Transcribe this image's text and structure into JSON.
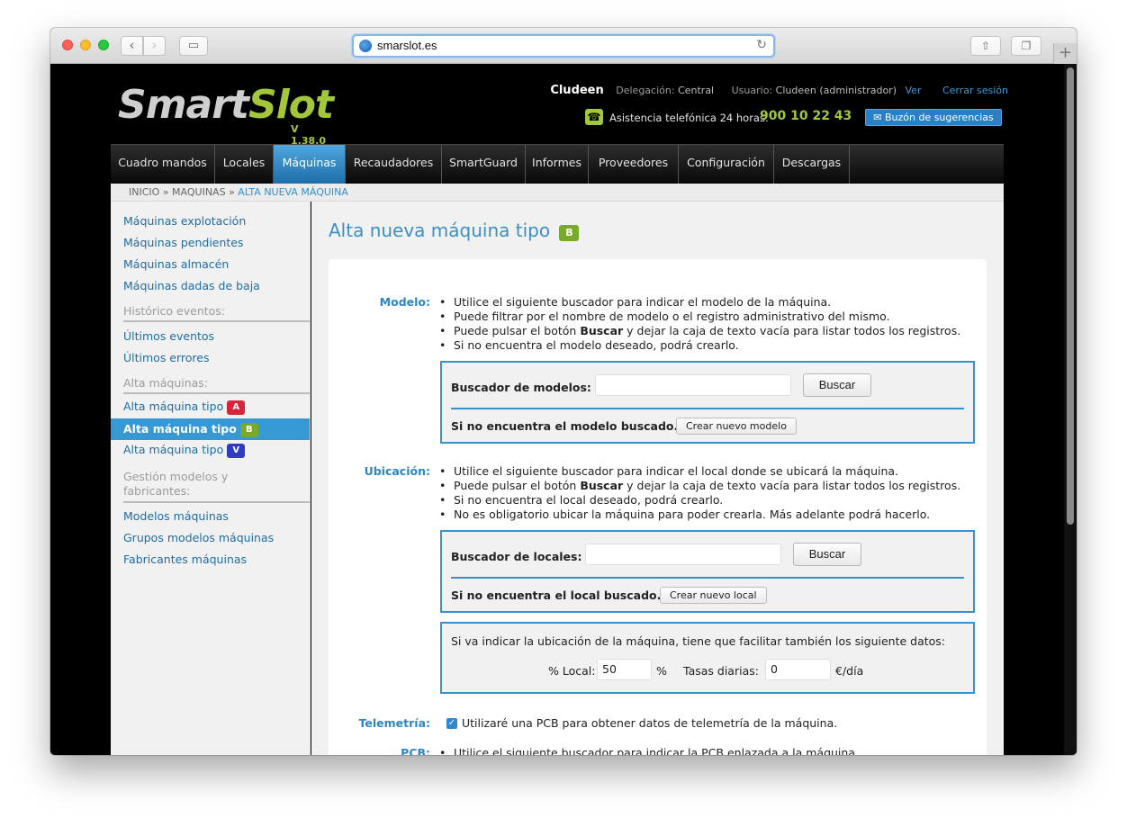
{
  "browser": {
    "url": "smarslot.es",
    "icons": {
      "back": "chevron-left-icon",
      "forward": "chevron-right-icon",
      "sidebar": "sidebar-icon",
      "reload": "reload-icon",
      "share": "share-icon",
      "tabs": "tabs-icon",
      "new_tab": "plus-icon"
    }
  },
  "header": {
    "logo_main": "Smart",
    "logo_accent": "Slot",
    "version": "V 1.38.0",
    "company": "Cludeen",
    "delegation_label": "Delegación:",
    "delegation_value": "Central",
    "user_label": "Usuario:",
    "user_value": "Cludeen (administrador)",
    "view_link": "Ver",
    "logout_link": "Cerrar sesión",
    "phone_label": "Asistencia telefónica 24 horas:",
    "phone_number": "900 10 22 43",
    "suggestions_button": "Buzón de sugerencias"
  },
  "menu": {
    "items": [
      "Cuadro mandos",
      "Locales",
      "Máquinas",
      "Recaudadores",
      "SmartGuard",
      "Informes",
      "Proveedores",
      "Configuración",
      "Descargas"
    ],
    "active": "Máquinas"
  },
  "breadcrumb": {
    "home": "INICIO",
    "sep": "»",
    "section": "MAQUINAS",
    "current": "ALTA NUEVA MÁQUINA"
  },
  "sidebar": {
    "links_top": [
      "Máquinas explotación",
      "Máquinas pendientes",
      "Máquinas almacén",
      "Máquinas dadas de baja"
    ],
    "head_events": "Histórico eventos:",
    "links_events": [
      "Últimos eventos",
      "Últimos errores"
    ],
    "head_alta": "Alta máquinas:",
    "alta_items": [
      {
        "label": "Alta máquina tipo",
        "badge": "A"
      },
      {
        "label": "Alta máquina tipo",
        "badge": "B"
      },
      {
        "label": "Alta máquina tipo",
        "badge": "V"
      }
    ],
    "head_models_1": "Gestión modelos y",
    "head_models_2": "fabricantes:",
    "links_models": [
      "Modelos máquinas",
      "Grupos modelos máquinas",
      "Fabricantes máquinas"
    ]
  },
  "main": {
    "title": "Alta nueva máquina tipo",
    "title_badge": "B",
    "modelo": {
      "label": "Modelo:",
      "bullets": [
        "Utilice el siguiente buscador para indicar el modelo de la máquina.",
        "Puede filtrar por el nombre de modelo o el registro administrativo del mismo.",
        "Puede pulsar el botón ",
        "Si no encuentra el modelo deseado, podrá crearlo."
      ],
      "bullet3_bold": "Buscar",
      "bullet3_rest": " y dejar la caja de texto vacía para listar todos los registros.",
      "search_label": "Buscador de modelos:",
      "search_value": "",
      "search_button": "Buscar",
      "not_found_label": "Si no encuentra el modelo buscado.",
      "create_button": "Crear nuevo modelo"
    },
    "ubicacion": {
      "label": "Ubicación:",
      "bullet1": "Utilice el siguiente buscador para indicar el local donde se ubicará la máquina.",
      "bullet2_pre": "Puede pulsar el botón ",
      "bullet2_bold": "Buscar",
      "bullet2_rest": " y dejar la caja de texto vacía para listar todos los registros.",
      "bullet3": "Si no encuentra el local deseado, podrá crearlo.",
      "bullet4": "No es obligatorio ubicar la máquina para poder crearla. Más adelante podrá hacerlo.",
      "search_label": "Buscador de locales:",
      "search_value": "",
      "search_button": "Buscar",
      "not_found_label": "Si no encuentra el local buscado.",
      "create_button": "Crear nuevo local",
      "extra_info": "Si va indicar la ubicación de la máquina, tiene que facilitar también los siguiente datos:",
      "local_pct_label": "% Local:",
      "local_pct_value": "50",
      "local_pct_unit": "%",
      "tasas_label": "Tasas diarias:",
      "tasas_value": "0",
      "tasas_unit": "€/día"
    },
    "telemetria": {
      "label": "Telemetría:",
      "checked": true,
      "text": "Utilizaré una PCB para obtener datos de telemetría de la máquina."
    },
    "pcb": {
      "label": "PCB:",
      "bullet1": "Utilice el siguiente buscador para indicar la PCB enlazada a la máquina."
    }
  },
  "colors": {
    "accent_green": "#a3c73a",
    "accent_blue": "#3a8fc7",
    "badge_a": "#d9243a",
    "badge_b": "#7aaa2a",
    "badge_v": "#2f3cbf"
  }
}
